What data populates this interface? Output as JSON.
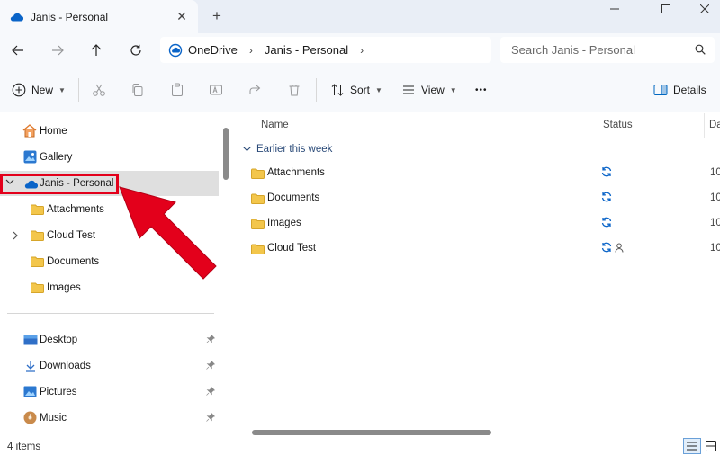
{
  "window": {
    "tab_title": "Janis - Personal",
    "tab_close_symbol": "✕",
    "new_tab_symbol": "+",
    "minimize_symbol": "—",
    "maximize_symbol": "☐",
    "close_symbol": "✕"
  },
  "address": {
    "crumbs": [
      "OneDrive",
      "Janis - Personal"
    ],
    "search_placeholder": "Search Janis - Personal"
  },
  "toolbar": {
    "new_label": "New",
    "sort_label": "Sort",
    "view_label": "View",
    "more_label": "•••",
    "details_label": "Details"
  },
  "nav": {
    "items": [
      {
        "label": "Home",
        "icon": "home-icon"
      },
      {
        "label": "Gallery",
        "icon": "gallery-icon"
      },
      {
        "label": "Janis - Personal",
        "icon": "onedrive-icon",
        "selected": true,
        "expanded": true
      },
      {
        "label": "Attachments",
        "icon": "folder-icon"
      },
      {
        "label": "Cloud Test",
        "icon": "folder-icon",
        "collapsed": true
      },
      {
        "label": "Documents",
        "icon": "folder-icon"
      },
      {
        "label": "Images",
        "icon": "folder-icon"
      }
    ],
    "quick_access": [
      {
        "label": "Desktop",
        "icon": "desktop-icon"
      },
      {
        "label": "Downloads",
        "icon": "downloads-icon"
      },
      {
        "label": "Pictures",
        "icon": "pictures-icon"
      },
      {
        "label": "Music",
        "icon": "music-icon"
      }
    ]
  },
  "content": {
    "columns": [
      "Name",
      "Status",
      "Da"
    ],
    "group": "Earlier this week",
    "rows": [
      {
        "name": "Attachments",
        "status": "sync-icon",
        "date": "10,"
      },
      {
        "name": "Documents",
        "status": "sync-icon",
        "date": "10,"
      },
      {
        "name": "Images",
        "status": "sync-icon",
        "date": "10,"
      },
      {
        "name": "Cloud Test",
        "status": "sync-shared-icon",
        "date": "10,"
      }
    ]
  },
  "statusbar": {
    "count": "4 items"
  },
  "colors": {
    "accent": "#0067c0",
    "highlight": "#e3001b",
    "folder": "#f3c64b"
  }
}
